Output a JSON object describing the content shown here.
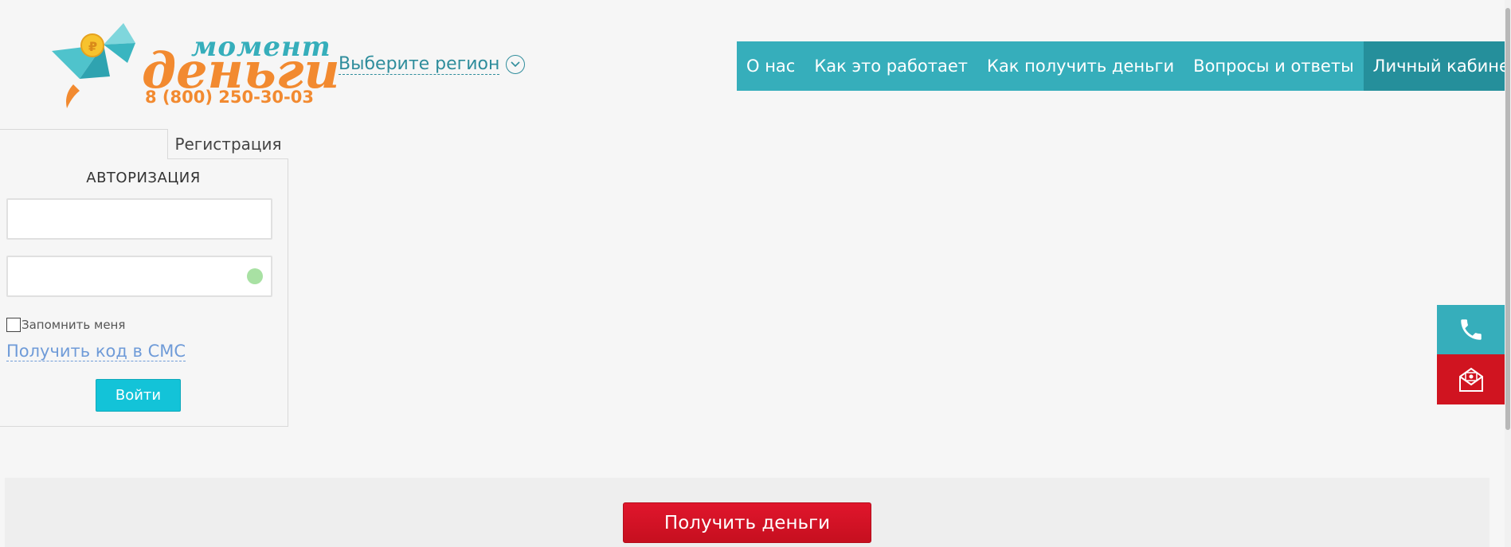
{
  "logo": {
    "word_top": "момент",
    "word_main": "деньги",
    "phone": "8 (800) 250-30-03",
    "colors": {
      "teal": "#36aebb",
      "orange": "#f28a30"
    }
  },
  "region": {
    "label": "Выберите регион"
  },
  "nav": {
    "items": [
      {
        "label": "О нас"
      },
      {
        "label": "Как это работает"
      },
      {
        "label": "Как получить деньги"
      },
      {
        "label": "Вопросы и ответы"
      },
      {
        "label": "Личный кабинет"
      }
    ]
  },
  "login": {
    "registration_tab": "Регистрация",
    "title": "АВТОРИЗАЦИЯ",
    "login_value": "",
    "password_value": "",
    "remember_label": "Запомнить меня",
    "sms_link": "Получить код в СМС",
    "submit_label": "Войти"
  },
  "side_widgets": {
    "phone_icon": "phone-icon",
    "mail_icon": "mail-icon"
  },
  "cta": {
    "label": "Получить деньги"
  }
}
